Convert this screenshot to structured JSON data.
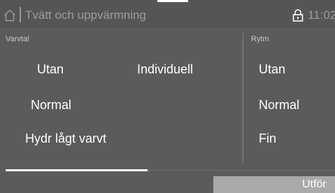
{
  "header": {
    "home_icon": "home-icon",
    "title": "Tvätt och uppvärmning",
    "lock_icon": "lock-icon",
    "time": "11:02"
  },
  "varvtal": {
    "label": "Varvtal",
    "options": [
      "Utan",
      "Individuell",
      "Normal",
      "Hydr lågt varvt"
    ]
  },
  "rytm": {
    "label": "Rytm",
    "options": [
      "Utan",
      "Normal",
      "Fin"
    ]
  },
  "footer": {
    "exec_label": "Utför"
  },
  "colors": {
    "background": "#5b5b5b",
    "text": "#ffffff",
    "dim_text": "#9c9c9c",
    "button": "#a9a9a9"
  }
}
